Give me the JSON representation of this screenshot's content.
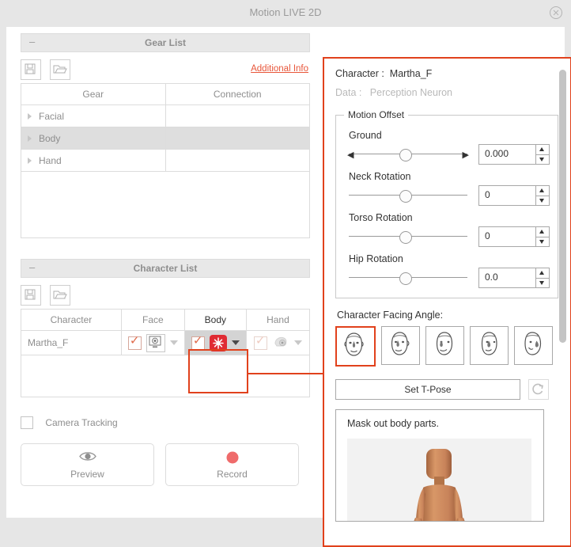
{
  "window": {
    "title": "Motion LIVE 2D",
    "close_icon": "close-circle-icon"
  },
  "left": {
    "gear_list": {
      "title": "Gear List",
      "collapse_glyph": "–",
      "save_icon": "save-icon",
      "open_icon": "open-folder-icon",
      "additional_info": "Additional Info",
      "columns": [
        "Gear",
        "Connection"
      ],
      "rows": [
        {
          "gear": "Facial",
          "connection": "",
          "selected": false
        },
        {
          "gear": "Body",
          "connection": "",
          "selected": true
        },
        {
          "gear": "Hand",
          "connection": "",
          "selected": false
        }
      ]
    },
    "character_list": {
      "title": "Character List",
      "collapse_glyph": "–",
      "save_icon": "save-icon",
      "open_icon": "open-folder-icon",
      "columns": [
        "Character",
        "Face",
        "Body",
        "Hand"
      ],
      "rows": [
        {
          "character": "Martha_F",
          "face": {
            "checked": true,
            "enabled": true,
            "device_icon": "webcam-icon"
          },
          "body": {
            "checked": true,
            "enabled": true,
            "device_icon": "motion-suit-icon",
            "highlighted": true
          },
          "hand": {
            "checked": false,
            "enabled": false,
            "device_icon": "glove-sensor-icon"
          }
        }
      ]
    },
    "camera_tracking": {
      "label": "Camera Tracking",
      "checked": false
    },
    "preview_button": {
      "label": "Preview",
      "icon": "eye-icon"
    },
    "record_button": {
      "label": "Record",
      "icon": "record-dot-icon"
    }
  },
  "right": {
    "character_label": "Character :",
    "character_value": "Martha_F",
    "data_label": "Data :",
    "data_value": "Perception Neuron",
    "motion_offset": {
      "legend": "Motion Offset",
      "sliders": [
        {
          "label": "Ground",
          "value": "0.000",
          "has_arrows": true
        },
        {
          "label": "Neck Rotation",
          "value": "0",
          "has_arrows": false
        },
        {
          "label": "Torso Rotation",
          "value": "0",
          "has_arrows": false
        },
        {
          "label": "Hip Rotation",
          "value": "0.0",
          "has_arrows": false
        }
      ]
    },
    "facing_angle": {
      "label": "Character Facing Angle:",
      "options": [
        {
          "name": "face-angle-front",
          "selected": true
        },
        {
          "name": "face-angle-slight-left",
          "selected": false
        },
        {
          "name": "face-angle-left",
          "selected": false
        },
        {
          "name": "face-angle-more-left",
          "selected": false
        },
        {
          "name": "face-angle-profile",
          "selected": false
        }
      ]
    },
    "tpose_button": "Set T-Pose",
    "refresh_icon": "refresh-icon",
    "mask_panel": {
      "label": "Mask out body parts.",
      "figure": "humanoid-avatar"
    }
  },
  "colors": {
    "accent_red": "#e1411c",
    "record_red": "#ef6b6b",
    "link_red": "#e8563a",
    "window_bg": "#e6e6e6",
    "skin": "#c98457"
  }
}
